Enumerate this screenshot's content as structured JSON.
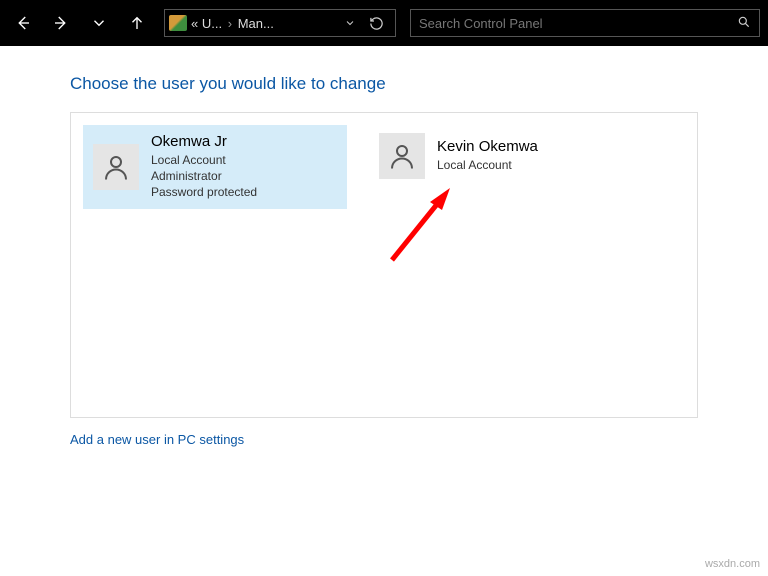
{
  "nav": {
    "address": {
      "icon_prefix": "«",
      "crumb1": "U...",
      "crumb2": "Man..."
    },
    "search_placeholder": "Search Control Panel"
  },
  "main": {
    "heading": "Choose the user you would like to change",
    "users": [
      {
        "name": "Okemwa Jr",
        "line1": "Local Account",
        "line2": "Administrator",
        "line3": "Password protected",
        "selected": true
      },
      {
        "name": "Kevin Okemwa",
        "line1": "Local Account",
        "line2": "",
        "line3": "",
        "selected": false
      }
    ],
    "add_link": "Add a new user in PC settings"
  },
  "watermark": "wsxdn.com"
}
